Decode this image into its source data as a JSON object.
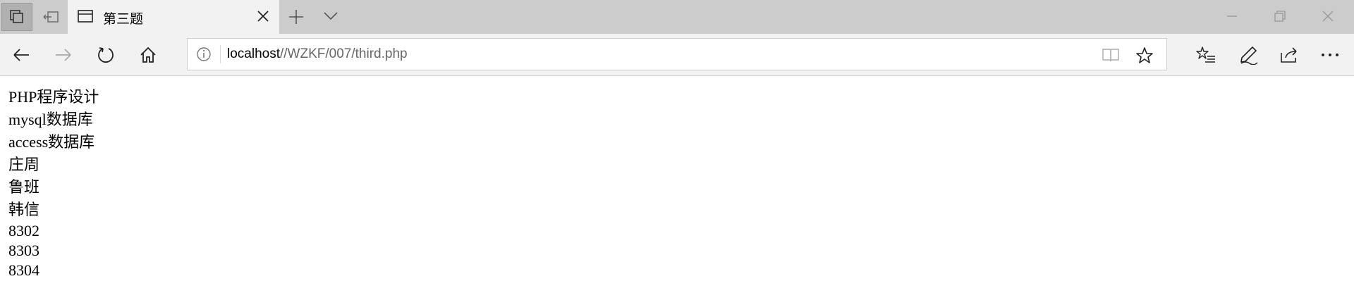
{
  "window": {
    "tab_title": "第三题"
  },
  "toolbar": {
    "url_host": "localhost",
    "url_path": "//WZKF/007/third.php"
  },
  "content": {
    "lines": [
      "PHP程序设计",
      "mysql数据库",
      "access数据库",
      "庄周",
      "鲁班",
      "韩信"
    ],
    "numbers": [
      "8302",
      "8303",
      "8304"
    ]
  },
  "icons": {
    "tabs_aside": "tabs-aside-icon",
    "set_aside": "set-tabs-aside-icon",
    "tab_page": "page-icon",
    "tab_close": "close-icon",
    "new_tab": "plus-icon",
    "tab_list": "chevron-down-icon",
    "back": "arrow-left-icon",
    "forward": "arrow-right-icon",
    "refresh": "refresh-icon",
    "home": "home-icon",
    "info": "info-icon",
    "reading_view": "book-icon",
    "favorite": "star-icon",
    "favorites_hub": "favorites-list-icon",
    "notes": "pen-icon",
    "share": "share-icon",
    "more": "ellipsis-icon"
  },
  "colors": {
    "tabstrip_bg": "#cccccc",
    "toolbar_bg": "#f2f2f2",
    "page_bg": "#ffffff",
    "url_path": "#666666"
  }
}
